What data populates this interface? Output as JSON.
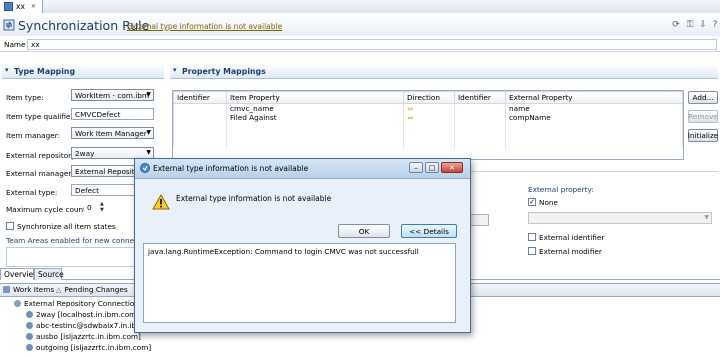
{
  "editor_tab": {
    "label": "xx",
    "close": "✕"
  },
  "header": {
    "title": "Synchronization Rule",
    "warning_link": "External type information is not available"
  },
  "name_field": {
    "label": "Name",
    "value": "xx"
  },
  "type_mapping": {
    "title": "Type Mapping",
    "item_type": {
      "label": "Item type:",
      "value": "WorkItem - com.ibm"
    },
    "item_type_qualifier": {
      "label": "Item type qualifier:",
      "value": "CMVCDefect"
    },
    "item_manager": {
      "label": "Item manager:",
      "value": "Work Item Manager"
    },
    "external_repository": {
      "label": "External repository:",
      "value": "2way"
    },
    "external_manager": {
      "label": "External manager:",
      "value": "External Repositor"
    },
    "external_type": {
      "label": "External type:",
      "value": "Defect"
    },
    "max_cycle": {
      "label": "Maximum cycle count:",
      "value": "0"
    },
    "sync_all": {
      "label": "Synchronize all item states",
      "checked": false
    },
    "team_areas": {
      "label": "Team Areas enabled for new connection"
    }
  },
  "property_mappings": {
    "title": "Property Mappings",
    "columns": [
      "Identifier",
      "Item Property",
      "Direction",
      "Identifier",
      "External Property"
    ],
    "rows": [
      {
        "identifier": "",
        "item_property": "cmvc_name",
        "direction": "⇔",
        "ext_identifier": "",
        "external_property": "name"
      },
      {
        "identifier": "",
        "item_property": "Filed Against",
        "direction": "⇔",
        "ext_identifier": "",
        "external_property": "compName"
      }
    ],
    "buttons": {
      "add": "Add...",
      "remove": "Remove",
      "initialize": "Initialize"
    }
  },
  "external_property": {
    "label": "External property:",
    "none_label": "None",
    "none_checked": true,
    "external_identifier": "External identifier",
    "external_modifier": "External modifier"
  },
  "bottom_tabs": [
    "Overview",
    "Source"
  ],
  "views": {
    "work_items": "Work Items",
    "pending_changes": "Pending Changes"
  },
  "tree": {
    "root": "External Repository Connections",
    "items": [
      "2way [localhost.in.ibm.com]",
      "abc-testinc@sdwbaix7.in.ibm",
      "ausbo [isljazzrtc.in.ibm.com]",
      "outgoing [isljazzrtc.in.ibm.com]"
    ]
  },
  "dialog": {
    "title": "External type information is not available",
    "message": "External type information is not available",
    "ok_label": "OK",
    "details_label": "<< Details",
    "details_text": "java.lang.RuntimeException: Command to login CMVC was not successfull"
  }
}
